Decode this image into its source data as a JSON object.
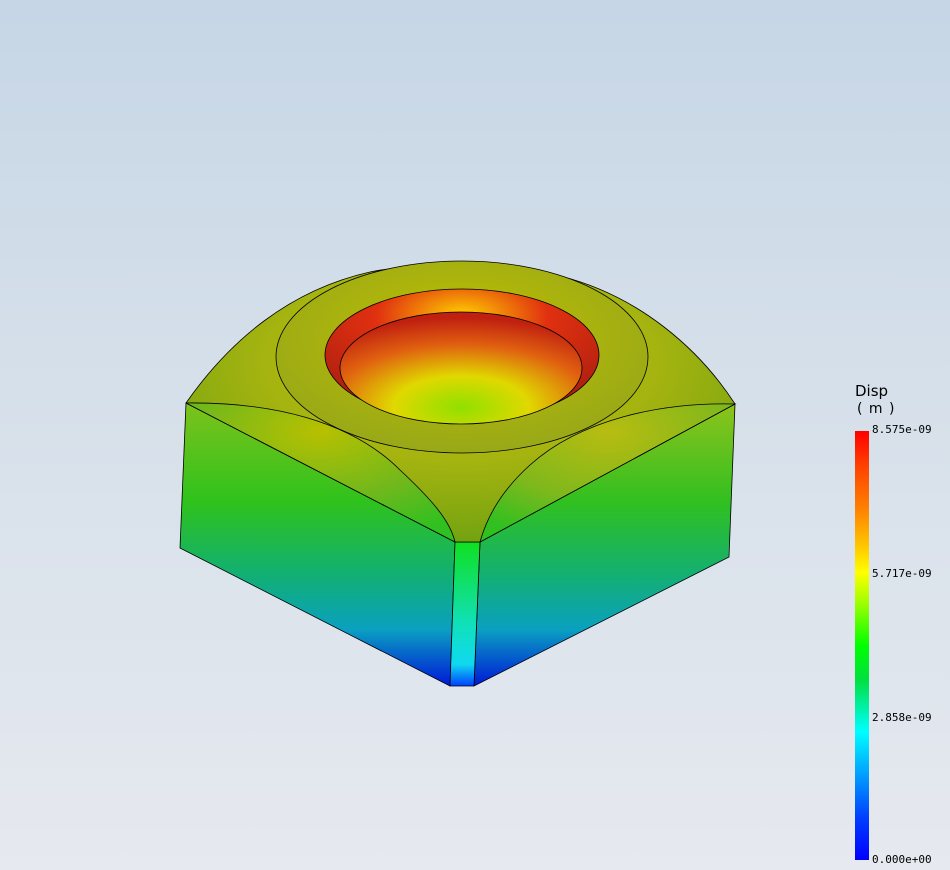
{
  "legend": {
    "title": "Disp",
    "unit": "( m )",
    "ticks": [
      {
        "label": "8.575e-09",
        "value": 8.575e-09
      },
      {
        "label": "5.717e-09",
        "value": 5.717e-09
      },
      {
        "label": "2.858e-09",
        "value": 2.858e-09
      },
      {
        "label": "0.000e+00",
        "value": 0.0
      }
    ],
    "max": 8.575e-09,
    "min": 0.0,
    "colormap": [
      "#0000ff",
      "#00ffff",
      "#00ff00",
      "#ffff00",
      "#ff0000"
    ]
  },
  "colors": {
    "background_top": "#c6d6e6",
    "background_bottom": "#e6e9ef",
    "edge": "#000000"
  }
}
